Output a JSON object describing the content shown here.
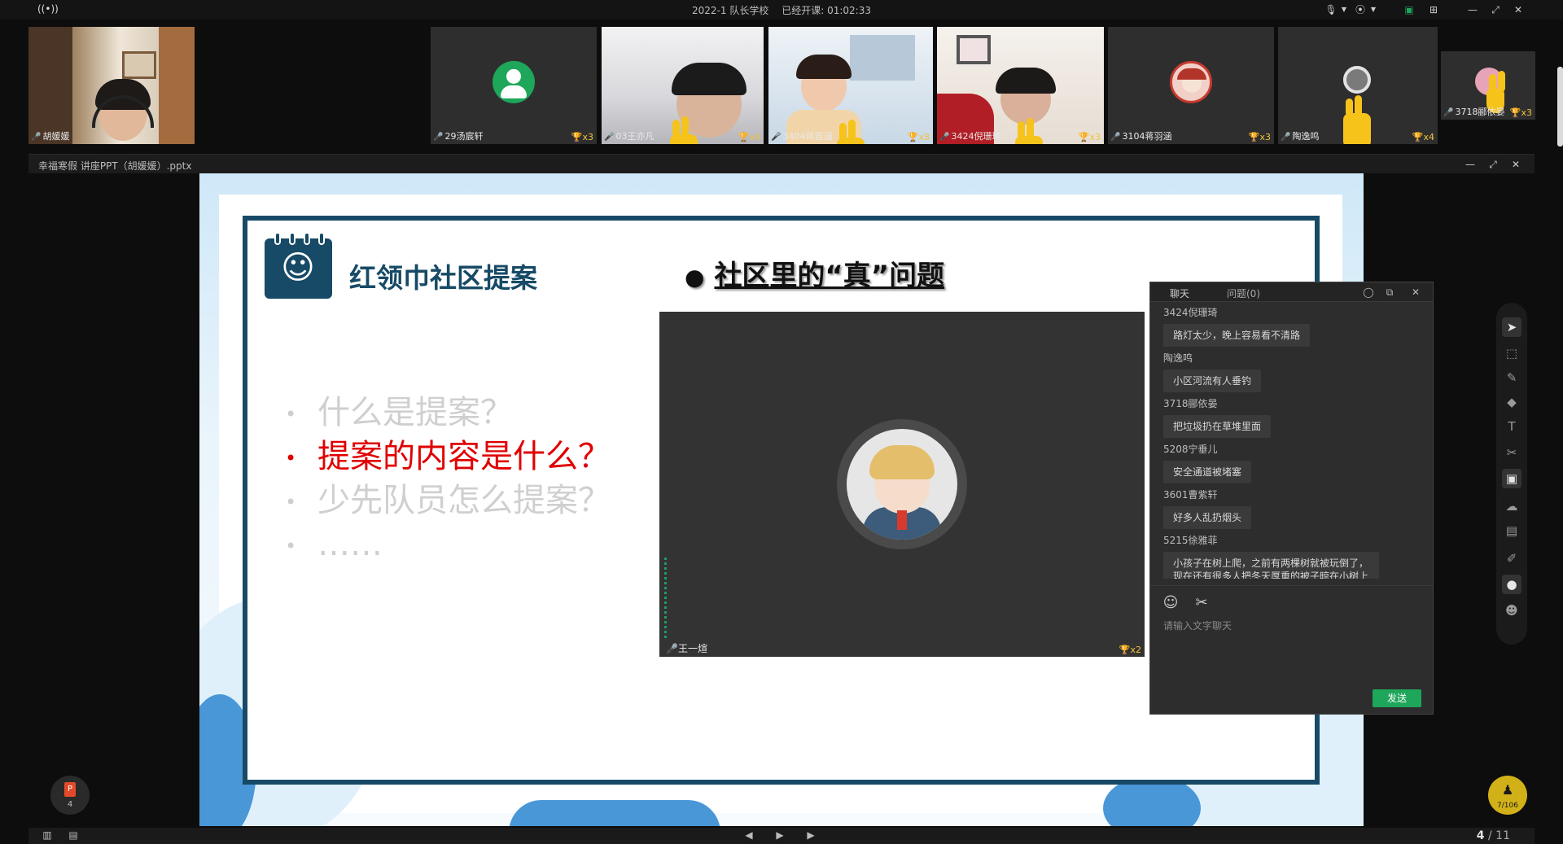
{
  "topbar": {
    "class_name": "2022-1 队长学校",
    "elapsed_label": "已经开课:",
    "elapsed_time": "01:02:33"
  },
  "teacher": {
    "name": "胡媛媛"
  },
  "participants": [
    {
      "name": "29汤宸轩",
      "cups": "x3",
      "avatar_color": "#1ea65a",
      "hand": false
    },
    {
      "name": "03王亦凡",
      "cups": "x4",
      "avatar_color": "",
      "hand": true
    },
    {
      "name": "3404蒋若涵",
      "cups": "x8",
      "avatar_color": "",
      "hand": true
    },
    {
      "name": "3424倪珊琦",
      "cups": "x3",
      "avatar_color": "",
      "hand": true
    },
    {
      "name": "3104蒋羽涵",
      "cups": "x3",
      "avatar_color": "#f1d0c8",
      "hand": false
    },
    {
      "name": "陶逸鸣",
      "cups": "x4",
      "avatar_color": "#6f6f6f",
      "hand": true
    },
    {
      "name": "3718郦依晏",
      "cups": "x3",
      "avatar_color": "#e7a4b8",
      "hand": true
    }
  ],
  "document": {
    "title": "幸福寒假 讲座PPT（胡媛媛）.pptx"
  },
  "slide": {
    "title": "红领巾社区提案",
    "heading_bullet": "●",
    "heading": "社区里的“真”问题",
    "bullets": [
      {
        "dot": "•",
        "text": "什么是提案？",
        "color": "#111111"
      },
      {
        "dot": "•",
        "text": "提案的内容是什么？",
        "color": "#e00000"
      },
      {
        "dot": "•",
        "text": "少先队员怎么提案？",
        "color": "#111111"
      },
      {
        "dot": "•",
        "text": "……",
        "color": "#111111"
      }
    ],
    "video": {
      "name": "王一煊",
      "cups": "x2"
    }
  },
  "chat": {
    "tab_chat": "聊天",
    "tab_questions": "问题(0)",
    "messages": [
      {
        "who": "3424倪珊琦",
        "text": "路灯太少，晚上容易看不清路"
      },
      {
        "who": "陶逸鸣",
        "text": "小区河流有人垂钓"
      },
      {
        "who": "3718郦依晏",
        "text": "把垃圾扔在草堆里面"
      },
      {
        "who": "5208宁垂儿",
        "text": "安全通道被堵塞"
      },
      {
        "who": "3601曹紫轩",
        "text": "好多人乱扔烟头"
      },
      {
        "who": "5215徐雅菲",
        "text": "小孩子在树上爬，之前有两棵树就被玩倒了，现在还有很多人把冬天厚重的被子晾在小树上"
      }
    ],
    "input_placeholder": "请输入文字聊天",
    "send_label": "发送"
  },
  "bottom": {
    "ppt_badge_count": "4",
    "present_count": "7/106",
    "page_current": "4",
    "page_sep": " / ",
    "page_total": "11"
  },
  "colors": {
    "brand_dark": "#174a66",
    "send_green": "#1ea65a",
    "trophy": "#f1c33e",
    "hand": "#f6c31b"
  }
}
